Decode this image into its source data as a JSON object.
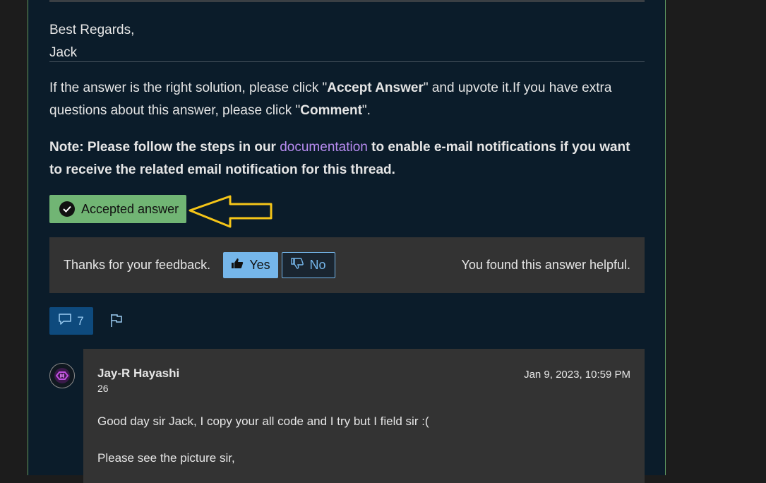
{
  "answer": {
    "signoff_line1": "Best Regards,",
    "signoff_line2": "Jack",
    "para1_a": "If the answer is the right solution, please click \"",
    "para1_accept": "Accept Answer",
    "para1_b": "\" and upvote it.If you have extra questions about this answer, please click \"",
    "para1_comment": "Comment",
    "para1_c": "\".",
    "note_a": "Note: Please follow the steps in our ",
    "note_link": "documentation",
    "note_b": " to enable e-mail notifications if you want to receive the related email notification for this thread.",
    "accepted_label": "Accepted answer",
    "accepted_color": "#71b574",
    "link_color": "#b88cf2",
    "annotation_color": "#f5c518"
  },
  "feedback": {
    "prompt": "Thanks for your feedback.",
    "yes_label": "Yes",
    "no_label": "No",
    "result": "You found this answer helpful."
  },
  "actions": {
    "comment_count": "7",
    "comment_icon": "speech-bubble-icon",
    "flag_icon": "flag-icon"
  },
  "comment": {
    "author": "Jay-R Hayashi",
    "reputation": "26",
    "date": "Jan 9, 2023, 10:59 PM",
    "line1": "Good day sir Jack, I copy your all code and I try but I field sir :(",
    "line2": "Please see the picture sir,"
  }
}
